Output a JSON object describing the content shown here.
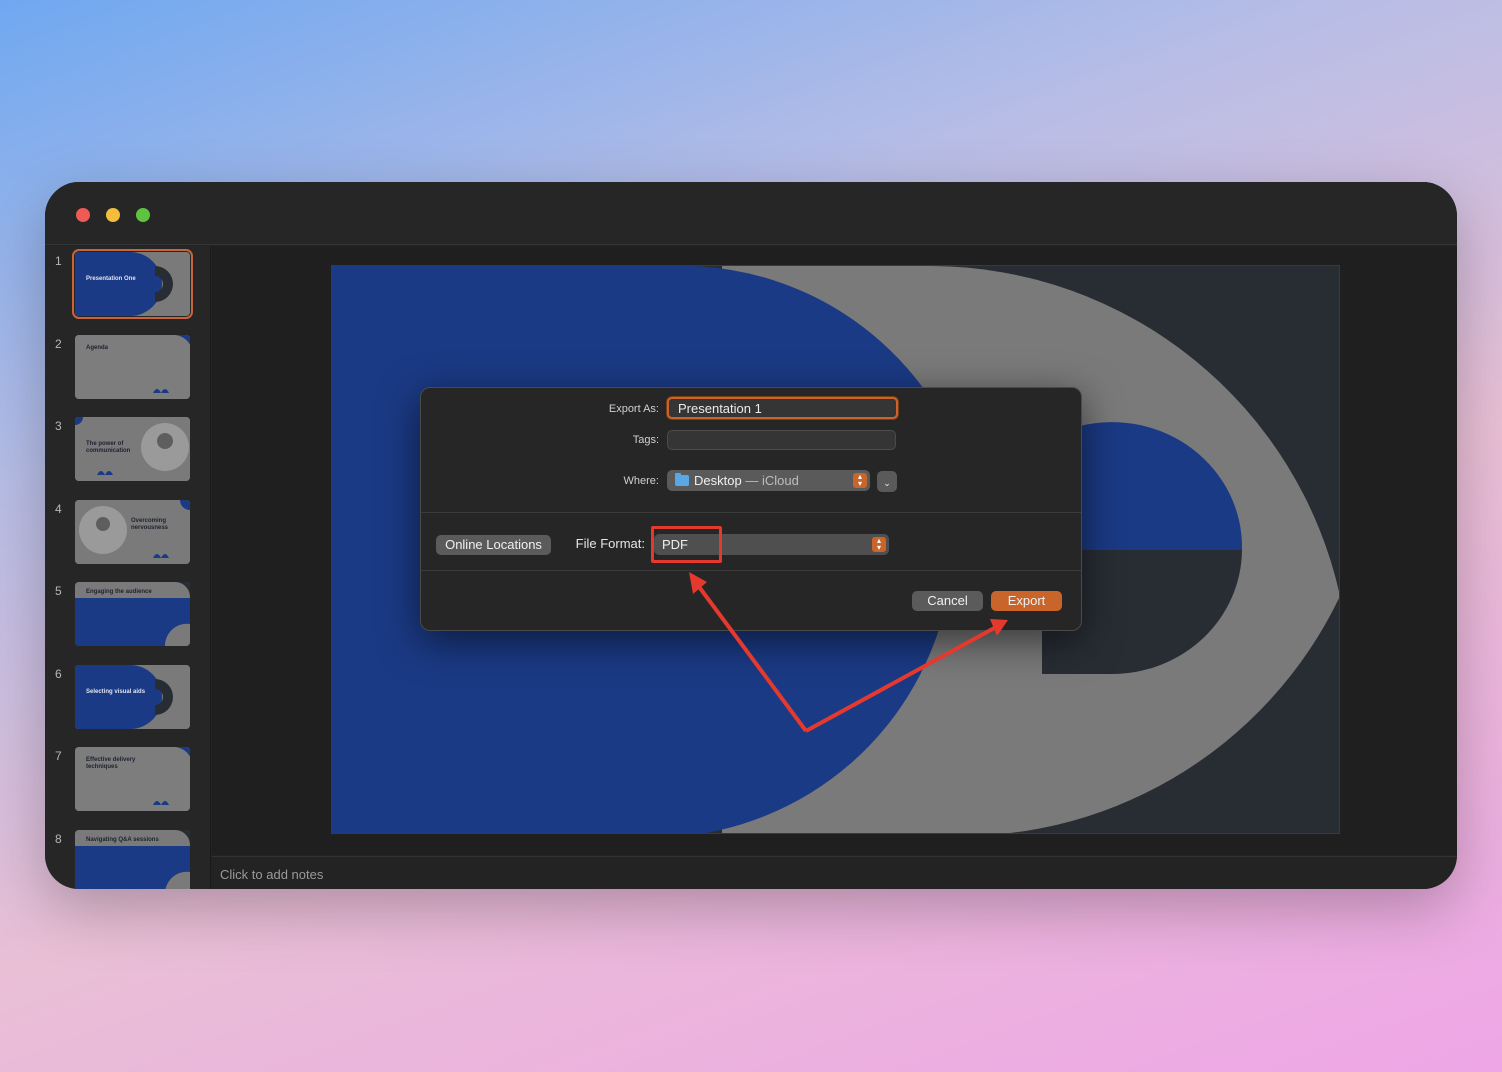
{
  "window": {
    "traffic_lights": [
      "close",
      "minimize",
      "zoom"
    ]
  },
  "sidebar": {
    "slides": [
      {
        "number": "1",
        "title": "Presentation One",
        "theme": "title",
        "active": true
      },
      {
        "number": "2",
        "title": "Agenda",
        "theme": "list",
        "active": false
      },
      {
        "number": "3",
        "title": "The power of communication",
        "theme": "photo-right",
        "active": false
      },
      {
        "number": "4",
        "title": "Overcoming nervousness",
        "theme": "photo-left",
        "active": false
      },
      {
        "number": "5",
        "title": "Engaging the audience",
        "theme": "blue-text",
        "active": false
      },
      {
        "number": "6",
        "title": "Selecting visual aids",
        "theme": "title",
        "active": false
      },
      {
        "number": "7",
        "title": "Effective delivery techniques",
        "theme": "list",
        "active": false
      },
      {
        "number": "8",
        "title": "Navigating Q&A sessions",
        "theme": "blue-text",
        "active": false
      }
    ]
  },
  "notes": {
    "placeholder": "Click to add notes"
  },
  "dialog": {
    "export_as_label": "Export As:",
    "export_as_value": "Presentation 1",
    "tags_label": "Tags:",
    "tags_value": "",
    "where_label": "Where:",
    "where_value": "Desktop",
    "where_sub": "— iCloud",
    "online_locations_label": "Online Locations",
    "file_format_label": "File Format:",
    "file_format_value": "PDF",
    "cancel_label": "Cancel",
    "export_label": "Export"
  },
  "colors": {
    "accent": "#c9652b",
    "slide_blue": "#1b3a85",
    "slide_gray": "#7a7a7a",
    "annotation_red": "#e6392e"
  }
}
